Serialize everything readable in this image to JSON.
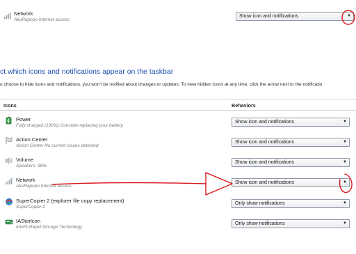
{
  "top": {
    "name": "Network",
    "description": "AkuRapopo Internet access",
    "behavior": "Show icon and notifications"
  },
  "heading": "ct which icons and notifications appear on the taskbar",
  "info": "u choose to hide icons and notifications, you won't be notified about changes or updates. To view hidden icons at any time, click the arrow next to the notificatio",
  "columns": {
    "icons": "Icons",
    "behaviors": "Behaviors"
  },
  "rows": [
    {
      "name": "Power",
      "description": "Fully charged (100%) Consider replacing your battery.",
      "behavior": "Show icon and notifications",
      "icon": "battery-icon"
    },
    {
      "name": "Action Center",
      "description": "Action Center  No current issues detected",
      "behavior": "Show icon and notifications",
      "icon": "flag-icon"
    },
    {
      "name": "Volume",
      "description": "Speakers: 68%",
      "behavior": "Show icon and notifications",
      "icon": "speaker-icon"
    },
    {
      "name": "Network",
      "description": "AkuRapopo Internet access",
      "behavior": "Show icon and notifications",
      "icon": "signal-bars-icon"
    },
    {
      "name": "SuperCopier 2 (explorer file copy replacement)",
      "description": "SuperCopier 2",
      "behavior": "Only show notifications",
      "icon": "supercopier-icon"
    },
    {
      "name": "IAStorIcon",
      "description": "Intel® Rapid Storage Technology",
      "behavior": "Only show notifications",
      "icon": "storage-icon"
    }
  ],
  "colors": {
    "heading": "#1e4fb0",
    "annotation": "#d8141a"
  }
}
